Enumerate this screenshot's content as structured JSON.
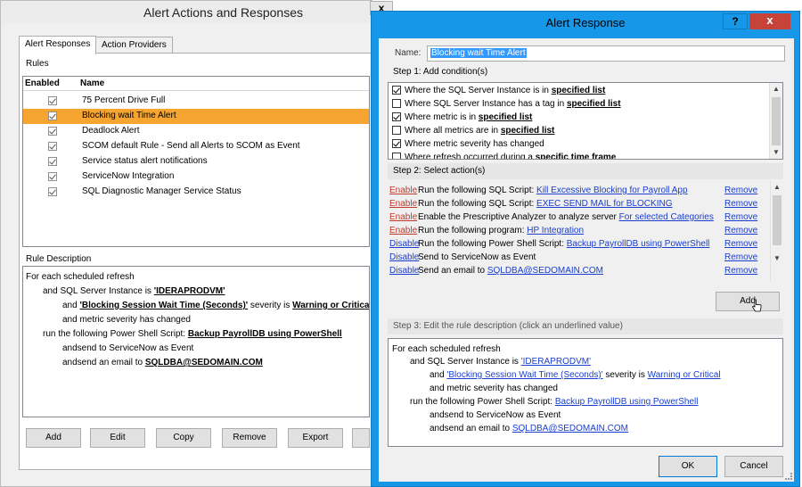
{
  "back_window": {
    "title": "Alert Actions and Responses",
    "close_glyph": "x",
    "tabs": [
      {
        "label": "Alert Responses"
      },
      {
        "label": "Action Providers"
      }
    ],
    "rules_label": "Rules",
    "columns": {
      "enabled": "Enabled",
      "name": "Name"
    },
    "rules": [
      {
        "name": "75 Percent Drive Full"
      },
      {
        "name": "Blocking wait Time Alert"
      },
      {
        "name": "Deadlock Alert"
      },
      {
        "name": "SCOM default Rule - Send all Alerts to SCOM as Event"
      },
      {
        "name": "Service status alert notifications"
      },
      {
        "name": "ServiceNow Integration"
      },
      {
        "name": "SQL Diagnostic Manager Service Status"
      }
    ],
    "rule_description_label": "Rule Description",
    "description": {
      "l1": "For each scheduled refresh",
      "l2a": "and SQL Server Instance is ",
      "l2b": "'IDERAPRODVM'",
      "l3a": "and ",
      "l3b": "'Blocking Session Wait Time (Seconds)'",
      "l3c": " severity is ",
      "l3d": "Warning or Critical",
      "l4": "and metric severity has changed",
      "l5a": "run the following Power Shell Script: ",
      "l5b": "Backup PayrollDB using PowerShell",
      "l6": "andsend to ServiceNow as Event",
      "l7a": "andsend an email to ",
      "l7b": "SQLDBA@SEDOMAIN.COM"
    },
    "buttons": {
      "add": "Add",
      "edit": "Edit",
      "copy": "Copy",
      "remove": "Remove",
      "export": "Export"
    }
  },
  "dialog": {
    "title": "Alert Response",
    "help_glyph": "?",
    "close_glyph": "x",
    "name_label": "Name:",
    "name_value": "Blocking wait Time Alert",
    "step1_label": "Step 1:  Add condition(s)",
    "conditions": [
      {
        "text": "Where the SQL Server Instance is in ",
        "link": "specified list",
        "checked": true
      },
      {
        "text": "Where SQL Server Instance has a tag in ",
        "link": "specified list",
        "checked": false
      },
      {
        "text": "Where metric is in ",
        "link": "specified list",
        "checked": true
      },
      {
        "text": "Where all metrics are in ",
        "link": "specified list",
        "checked": false
      },
      {
        "text": "Where metric severity has changed",
        "link": "",
        "checked": true
      },
      {
        "text": "Where refresh occurred during a ",
        "link": "specific time frame",
        "checked": false
      }
    ],
    "step2_label": "Step 2:  Select action(s)",
    "actions": [
      {
        "toggle": "Enable",
        "text": "Run the following SQL Script: ",
        "link": "Kill Excessive Blocking for Payroll App",
        "remove": "Remove"
      },
      {
        "toggle": "Enable",
        "text": "Run the following SQL Script: ",
        "link": "EXEC SEND MAIL for BLOCKING",
        "remove": "Remove"
      },
      {
        "toggle": "Enable",
        "text": "Enable the Prescriptive Analyzer to analyze server ",
        "link": "For selected Categories",
        "remove": "Remove"
      },
      {
        "toggle": "Enable",
        "text": "Run the following program: ",
        "link": "HP Integration",
        "remove": "Remove"
      },
      {
        "toggle": "Disable",
        "text": "Run the following Power Shell Script: ",
        "link": "Backup PayrollDB using PowerShell",
        "remove": "Remove"
      },
      {
        "toggle": "Disable",
        "text": "Send to ServiceNow as Event",
        "link": "",
        "remove": "Remove"
      },
      {
        "toggle": "Disable",
        "text": "Send an email to ",
        "link": "SQLDBA@SEDOMAIN.COM",
        "remove": "Remove"
      }
    ],
    "add_button": "Add",
    "step3_label": "Step 3:  Edit the rule description (click an underlined value)",
    "rule_description": {
      "l1": "For each scheduled refresh",
      "l2a": "and SQL Server Instance is ",
      "l2b": "'IDERAPRODVM'",
      "l3a": "and ",
      "l3b": "'Blocking Session Wait Time (Seconds)'",
      "l3c": " severity is ",
      "l3d": "Warning or Critical",
      "l4": "and metric severity has changed",
      "l5a": "run the following Power Shell Script: ",
      "l5b": "Backup PayrollDB using PowerShell",
      "l6": "andsend to ServiceNow as Event",
      "l7a": "andsend an email to ",
      "l7b": "SQLDBA@SEDOMAIN.COM"
    },
    "ok_button": "OK",
    "cancel_button": "Cancel"
  },
  "colors": {
    "dialog_frame": "#1797e8",
    "selected_row": "#f7a531",
    "enable_link": "#c0392b",
    "disable_link": "#1a3ecf",
    "close_button": "#c7433a"
  }
}
